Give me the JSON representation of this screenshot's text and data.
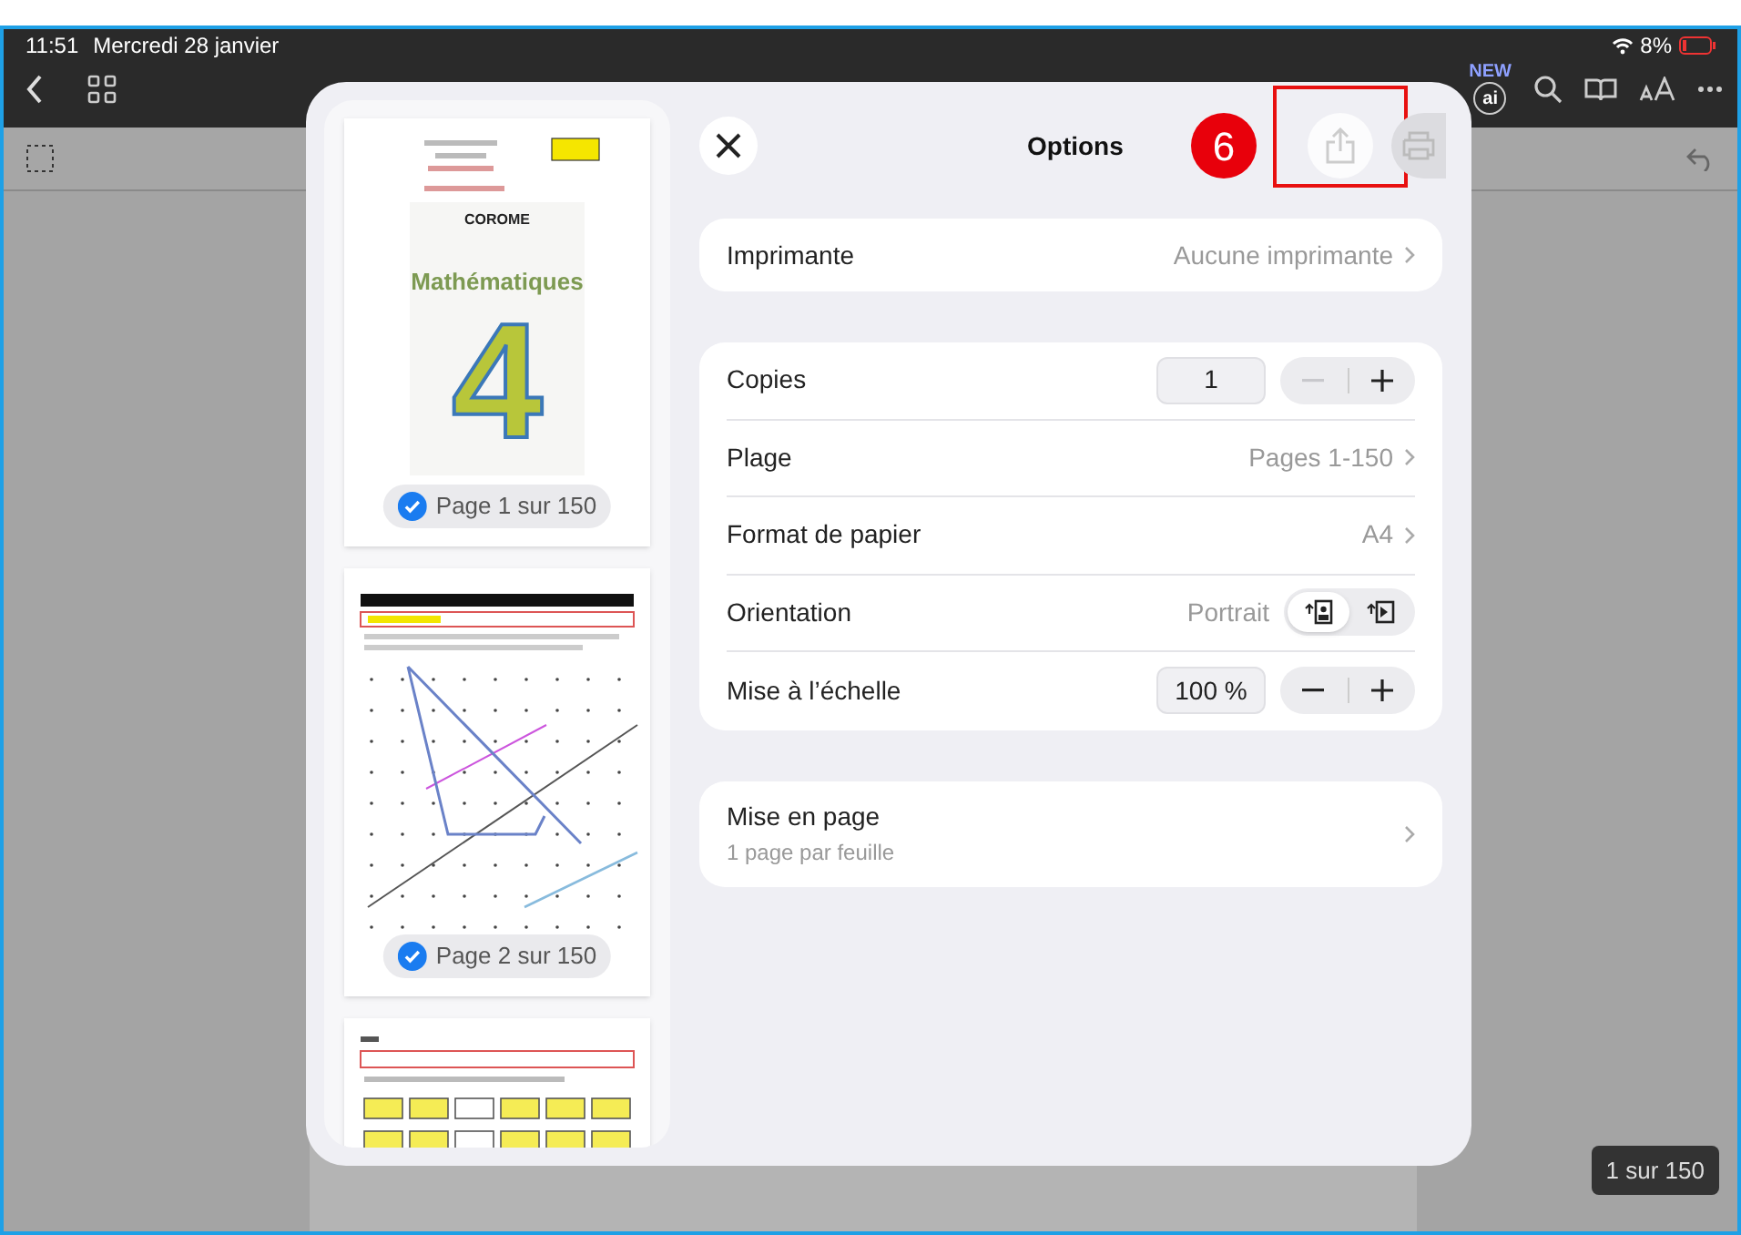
{
  "status_bar": {
    "time": "11:51",
    "date": "Mercredi 28 janvier",
    "battery": "8%"
  },
  "toolbar": {
    "new_badge": "NEW",
    "ai_label": "ai"
  },
  "page_counter": "1 sur 150",
  "dialog": {
    "title": "Options",
    "annotation": "6",
    "thumbnails": [
      {
        "kind": "cover",
        "selected": true,
        "caption": "Page 1 sur 150",
        "publisher": "COROME",
        "heading": "Mathématiques",
        "numeral": "4"
      },
      {
        "kind": "grid",
        "selected": true,
        "caption": "Page 2 sur 150"
      },
      {
        "kind": "table"
      }
    ],
    "printer": {
      "label": "Imprimante",
      "value": "Aucune imprimante"
    },
    "settings": [
      {
        "kind": "stepper",
        "label": "Copies",
        "value": "1",
        "minus_disabled": true
      },
      {
        "kind": "link",
        "label": "Plage",
        "value": "Pages 1-150"
      },
      {
        "kind": "link",
        "label": "Format de papier",
        "value": "A4"
      },
      {
        "kind": "orientation",
        "label": "Orientation",
        "value": "Portrait",
        "options": [
          {
            "selected": true
          },
          {
            "selected": false
          }
        ]
      },
      {
        "kind": "stepper",
        "label": "Mise à l’échelle",
        "value": "100 %",
        "minus_disabled": false
      }
    ],
    "layout": {
      "label": "Mise en page",
      "subtitle": "1 page par feuille"
    }
  }
}
